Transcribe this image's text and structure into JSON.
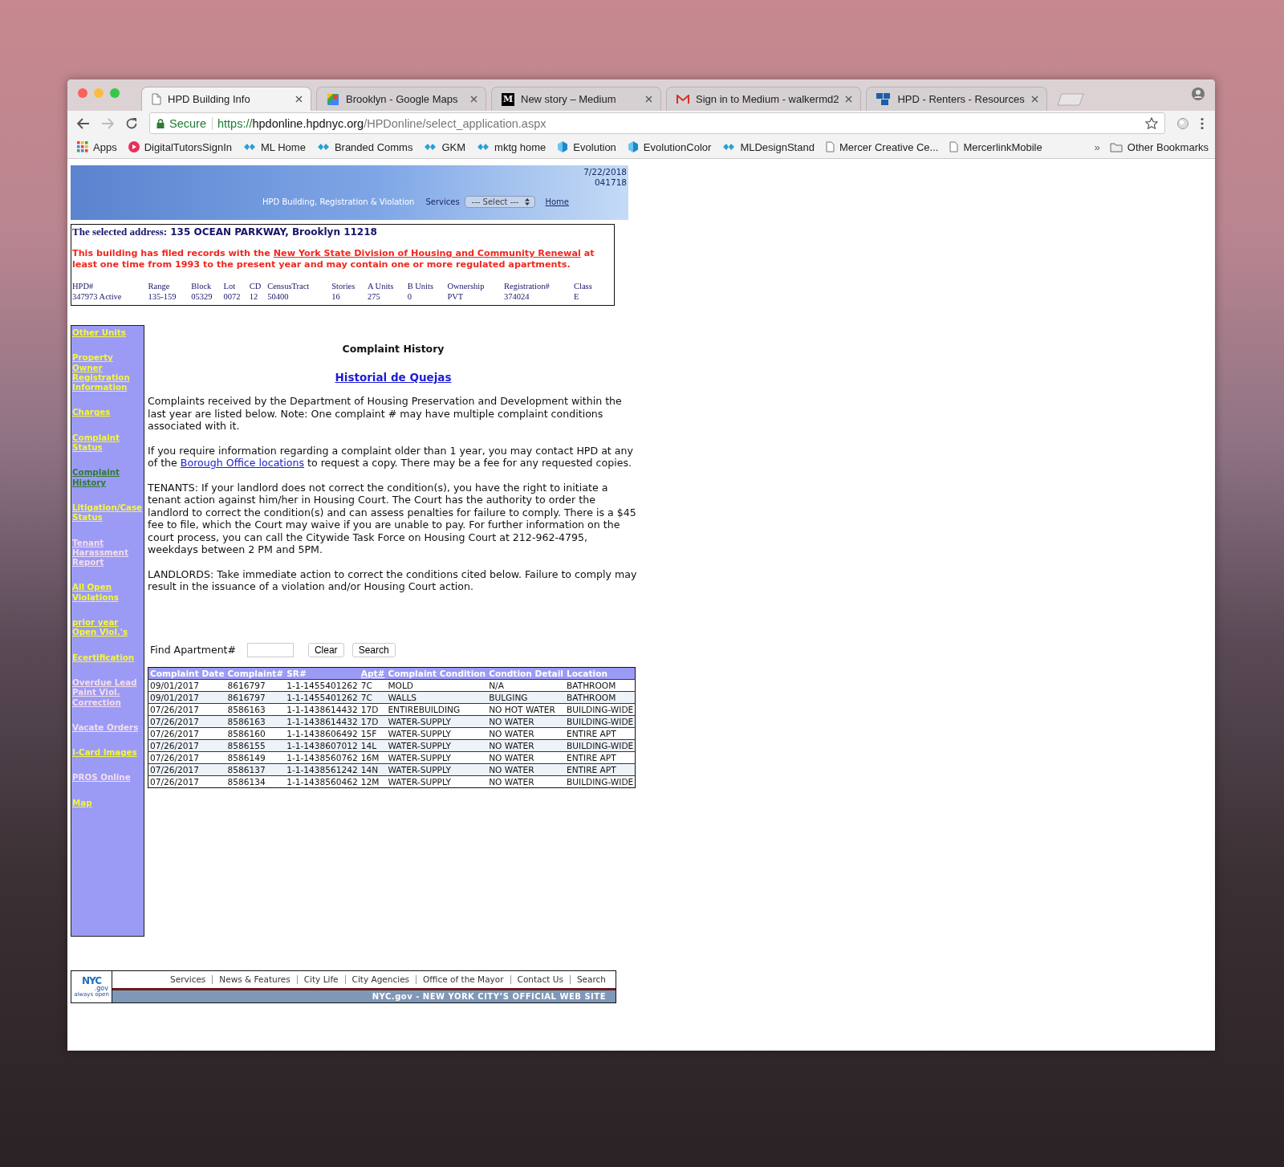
{
  "browser": {
    "tabs": [
      {
        "title": "HPD Building Info",
        "kind": "page",
        "selected": true
      },
      {
        "title": "Brooklyn - Google Maps",
        "kind": "maps",
        "selected": false
      },
      {
        "title": "New story – Medium",
        "kind": "medium",
        "icon_text": "M",
        "selected": false
      },
      {
        "title": "Sign in to Medium - walkermd2",
        "kind": "gmail",
        "selected": false
      },
      {
        "title": "HPD - Renters - Resources",
        "kind": "nyc",
        "selected": false
      }
    ],
    "address": {
      "secure_label": "Secure",
      "scheme": "https://",
      "host": "hpdonline.hpdnyc.org",
      "path": "/HPDonline/select_application.aspx"
    },
    "bookmarks": [
      {
        "label": "Apps",
        "kind": "apps"
      },
      {
        "label": "DigitalTutorsSignIn",
        "kind": "circle"
      },
      {
        "label": "ML Home",
        "kind": "link"
      },
      {
        "label": "Branded Comms",
        "kind": "link"
      },
      {
        "label": "GKM",
        "kind": "link"
      },
      {
        "label": "mktg home",
        "kind": "link"
      },
      {
        "label": "Evolution",
        "kind": "cube"
      },
      {
        "label": "EvolutionColor",
        "kind": "cube"
      },
      {
        "label": "MLDesignStand",
        "kind": "link"
      },
      {
        "label": "Mercer Creative Ce...",
        "kind": "page"
      },
      {
        "label": "MercerlinkMobile",
        "kind": "page"
      }
    ],
    "overflow": "»",
    "other_bookmarks": "Other Bookmarks"
  },
  "header": {
    "date": "7/22/2018",
    "code": "041718",
    "title": "HPD Building, Registration & Violation",
    "services_label": "Services",
    "services_select": "--- Select ---",
    "home_link": "Home"
  },
  "address_box": {
    "label": "The selected address:",
    "address": "135 OCEAN PARKWAY, Brooklyn 11218",
    "notice_before": "This building has filed records with the ",
    "notice_link": "New York State Division of Housing and Community Renewal",
    "notice_after": " at least one time from 1993 to the present year and may contain one or more regulated apartments.",
    "columns": [
      "HPD#",
      "Range",
      "Block",
      "Lot",
      "CD",
      "CensusTract",
      "Stories",
      "A Units",
      "B Units",
      "Ownership",
      "Registration#",
      "Class"
    ],
    "values": [
      "347973  Active",
      "135-159",
      "05329",
      "0072",
      "12",
      "50400",
      "16",
      "275",
      "0",
      "PVT",
      "374024",
      "E"
    ]
  },
  "sidebar": {
    "items": [
      {
        "label": "Other Units",
        "visited": false,
        "selected": false
      },
      {
        "label": "Property Owner Registration Information",
        "visited": false,
        "selected": false
      },
      {
        "label": "Charges",
        "visited": false,
        "selected": false
      },
      {
        "label": "Complaint Status",
        "visited": false,
        "selected": false
      },
      {
        "label": "Complaint History",
        "visited": false,
        "selected": true
      },
      {
        "label": "Litigation/Case Status",
        "visited": false,
        "selected": false
      },
      {
        "label": "Tenant Harassment Report",
        "visited": true,
        "selected": false
      },
      {
        "label": "All Open Violations",
        "visited": false,
        "selected": false
      },
      {
        "label": "prior year Open Viol.'s",
        "visited": false,
        "selected": false
      },
      {
        "label": "Ecertification",
        "visited": false,
        "selected": false
      },
      {
        "label": "Overdue Lead Paint Viol. Correction",
        "visited": true,
        "selected": false
      },
      {
        "label": "Vacate Orders",
        "visited": true,
        "selected": false
      },
      {
        "label": "I-Card Images",
        "visited": false,
        "selected": false
      },
      {
        "label": "PROS Online",
        "visited": true,
        "selected": false
      },
      {
        "label": "Map",
        "visited": false,
        "selected": false
      }
    ]
  },
  "main": {
    "title": "Complaint History",
    "spanish_link": "Historial de Quejas",
    "paragraphs": [
      {
        "text": "Complaints received by the Department of Housing Preservation and Development within the last year are listed below. Note: One complaint # may have multiple complaint conditions associated with it."
      },
      {
        "text": "If you require information regarding a complaint older than 1 year, you may contact HPD at any of the ",
        "link": "Borough Office locations",
        "after": " to request a copy. There may be a fee for any requested copies."
      },
      {
        "text": "TENANTS: If your landlord does not correct the condition(s), you have the right to initiate a tenant action against him/her in Housing Court. The Court has the authority to order the landlord to correct the condition(s) and can assess penalties for failure to comply. There is a $45 fee to file, which the Court may waive if you are unable to pay. For further information on the court process, you can call the Citywide Task Force on Housing Court at 212-962-4795, weekdays between 2 PM and 5PM."
      },
      {
        "text": "LANDLORDS: Take immediate action to correct the conditions cited below. Failure to comply may result in the issuance of a violation and/or Housing Court action."
      }
    ],
    "find": {
      "label": "Find Apartment#",
      "buttons": [
        "Clear",
        "Search"
      ]
    },
    "table": {
      "columns": [
        {
          "label": "Complaint Date",
          "sortable": false
        },
        {
          "label": "Complaint#",
          "sortable": false
        },
        {
          "label": "SR#",
          "sortable": false
        },
        {
          "label": "Apt#",
          "sortable": true
        },
        {
          "label": "Complaint Condition",
          "sortable": false
        },
        {
          "label": "Condtion Detail",
          "sortable": false
        },
        {
          "label": "Location",
          "sortable": false
        }
      ],
      "rows": [
        [
          "09/01/2017",
          "8616797",
          "1-1-1455401262",
          "7C",
          "MOLD",
          "N/A",
          "BATHROOM"
        ],
        [
          "09/01/2017",
          "8616797",
          "1-1-1455401262",
          "7C",
          "WALLS",
          "BULGING",
          "BATHROOM"
        ],
        [
          "07/26/2017",
          "8586163",
          "1-1-1438614432",
          "17D",
          "ENTIREBUILDING",
          "NO HOT WATER",
          "BUILDING-WIDE"
        ],
        [
          "07/26/2017",
          "8586163",
          "1-1-1438614432",
          "17D",
          "WATER-SUPPLY",
          "NO WATER",
          "BUILDING-WIDE"
        ],
        [
          "07/26/2017",
          "8586160",
          "1-1-1438606492",
          "15F",
          "WATER-SUPPLY",
          "NO WATER",
          "ENTIRE APT"
        ],
        [
          "07/26/2017",
          "8586155",
          "1-1-1438607012",
          "14L",
          "WATER-SUPPLY",
          "NO WATER",
          "BUILDING-WIDE"
        ],
        [
          "07/26/2017",
          "8586149",
          "1-1-1438560762",
          "16M",
          "WATER-SUPPLY",
          "NO WATER",
          "ENTIRE APT"
        ],
        [
          "07/26/2017",
          "8586137",
          "1-1-1438561242",
          "14N",
          "WATER-SUPPLY",
          "NO WATER",
          "ENTIRE APT"
        ],
        [
          "07/26/2017",
          "8586134",
          "1-1-1438560462",
          "12M",
          "WATER-SUPPLY",
          "NO WATER",
          "BUILDING-WIDE"
        ]
      ]
    }
  },
  "footer": {
    "logo_lines": [
      "NYC",
      ".gov",
      "always open"
    ],
    "links": [
      "Services",
      "News & Features",
      "City Life",
      "City Agencies",
      "Office of the Mayor",
      "Contact Us",
      "Search"
    ],
    "tagline": "NYC.gov - NEW YORK CITY’S OFFICIAL WEB SITE"
  }
}
